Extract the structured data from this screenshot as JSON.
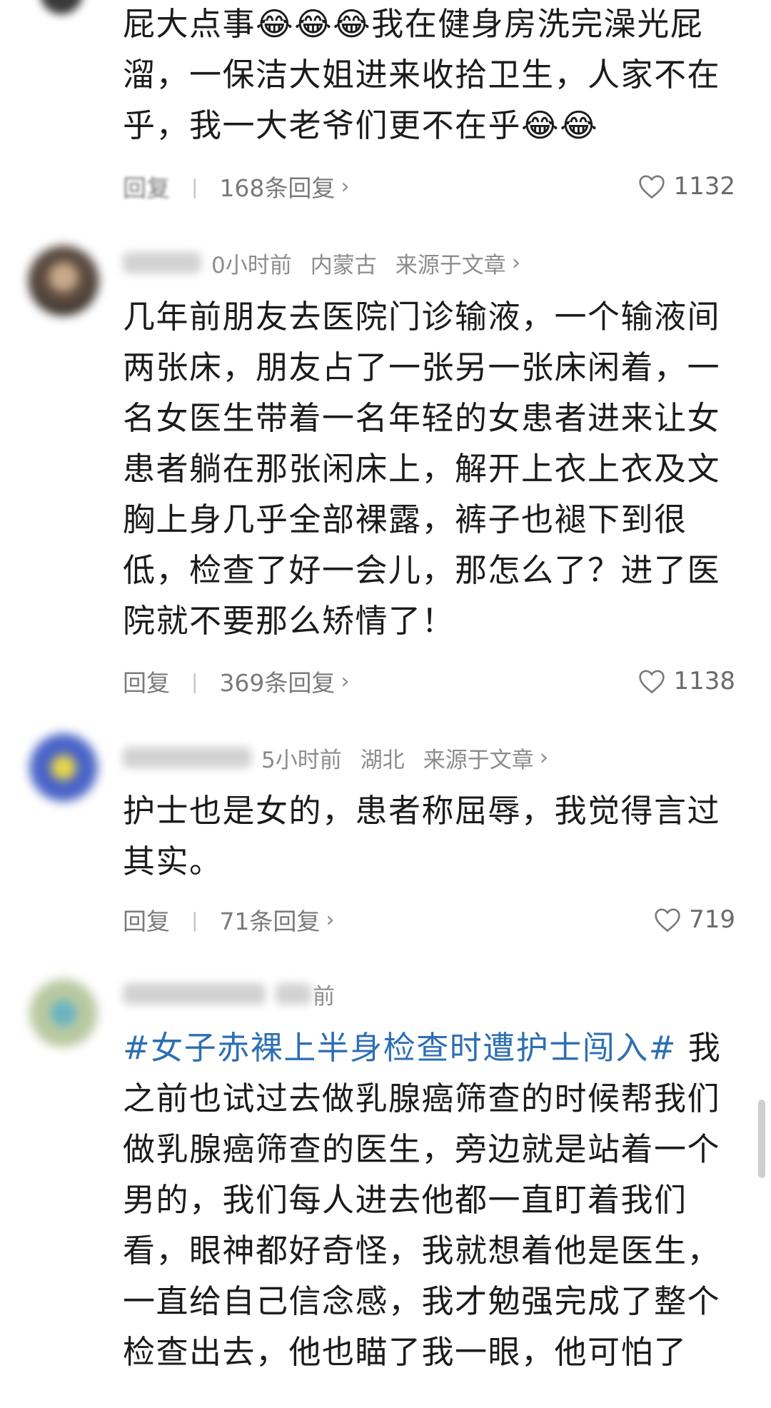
{
  "comments": [
    {
      "text": "屁大点事😂😂😂我在健身房洗完澡光屁溜，一保洁大姐进来收拾卫生，人家不在乎，我一大老爷们更不在乎😂😂",
      "reply_label": "回复",
      "replies": "168条回复",
      "likes": "1132"
    },
    {
      "time": "0小时前",
      "location": "内蒙古",
      "source": "来源于文章",
      "text": "几年前朋友去医院门诊输液，一个输液间两张床，朋友占了一张另一张床闲着，一名女医生带着一名年轻的女患者进来让女患者躺在那张闲床上，解开上衣上衣及文胸上身几乎全部裸露，裤子也褪下到很低，检查了好一会儿，那怎么了？进了医院就不要那么矫情了！",
      "reply_label": "回复",
      "replies": "369条回复",
      "likes": "1138"
    },
    {
      "time": "5小时前",
      "location": "湖北",
      "source": "来源于文章",
      "text": "护士也是女的，患者称屈辱，我觉得言过其实。",
      "reply_label": "回复",
      "replies": "71条回复",
      "likes": "719"
    },
    {
      "time": "前",
      "hashtag": "#女子赤裸上半身检查时遭护士闯入#",
      "text": " 我之前也试过去做乳腺癌筛查的时候帮我们做乳腺癌筛查的医生，旁边就是站着一个男的，我们每人进去他都一直盯着我们看，眼神都好奇怪，我就想着他是医生，一直给自己信念感，我才勉强完成了整个检查出去，他也瞄了我一眼，他可怕了"
    }
  ],
  "icons": {
    "heart": "heart-outline-icon",
    "chevron": "chevron-right-icon",
    "source_chevron": "chevron-right-icon"
  },
  "colors": {
    "hashtag": "#2d6fb3",
    "meta": "#8c8c8c",
    "text": "#1b1b1b"
  }
}
